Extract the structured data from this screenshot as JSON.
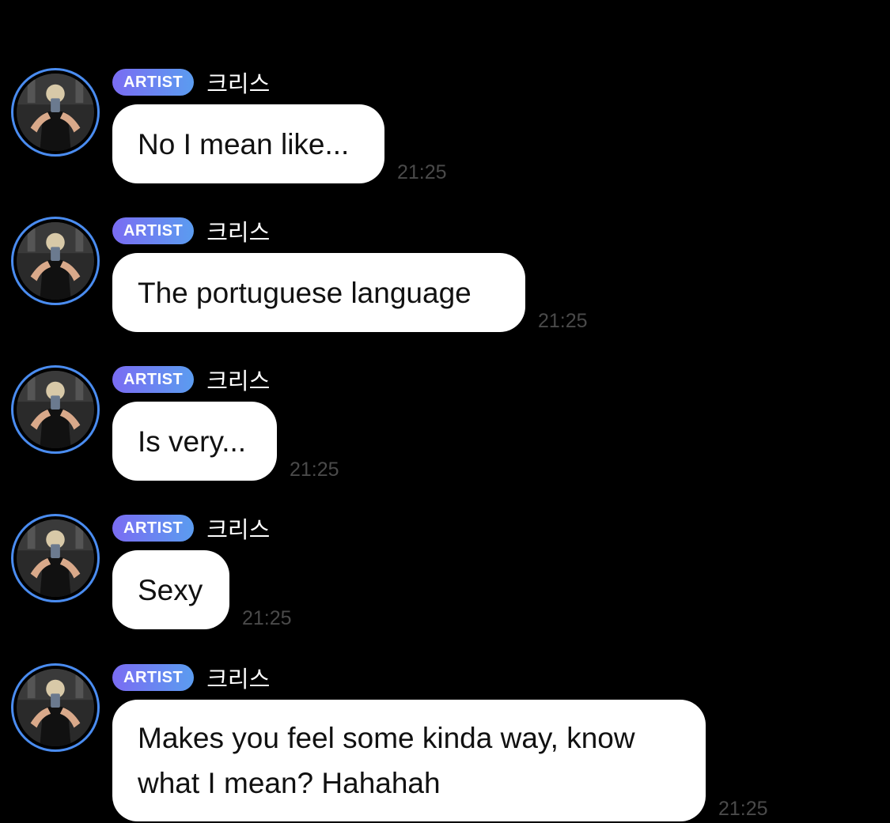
{
  "messages": [
    {
      "badge": "ARTIST",
      "sender": "크리스",
      "text": "No I mean like...",
      "time": "21:25"
    },
    {
      "badge": "ARTIST",
      "sender": "크리스",
      "text": "The portuguese language",
      "time": "21:25"
    },
    {
      "badge": "ARTIST",
      "sender": "크리스",
      "text": "Is very...",
      "time": "21:25"
    },
    {
      "badge": "ARTIST",
      "sender": "크리스",
      "text": "Sexy",
      "time": "21:25"
    },
    {
      "badge": "ARTIST",
      "sender": "크리스",
      "text": "Makes you feel some kinda way, know\nwhat I mean? Hahahah",
      "time": "21:25"
    }
  ],
  "colors": {
    "background": "#000000",
    "bubble": "#ffffff",
    "badge_gradient_start": "#7a6cf2",
    "badge_gradient_end": "#5b9cf0",
    "avatar_ring": "#4a8cf0",
    "timestamp": "#4a4a4a"
  },
  "icons": {
    "avatar": "profile-photo"
  }
}
